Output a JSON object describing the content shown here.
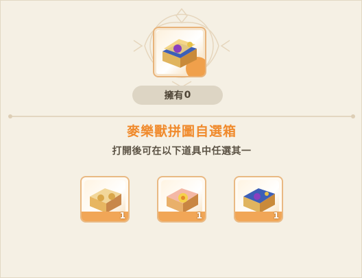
{
  "owned": {
    "label": "擁有",
    "count": "0"
  },
  "title": "麥樂獸拼圖自選箱",
  "subtitle": "打開後可在以下道具中任選其一",
  "items": [
    {
      "name": "item-chest-gold",
      "count": "1",
      "icon": "gold-chest-icon",
      "accent": "#e8c66a"
    },
    {
      "name": "item-chest-pink",
      "count": "1",
      "icon": "pink-chest-icon",
      "accent": "#f29a8a"
    },
    {
      "name": "item-chest-blue",
      "count": "1",
      "icon": "blue-chest-icon",
      "accent": "#3d5fb7"
    }
  ],
  "colors": {
    "accent": "#f08a2c",
    "background": "#f5f0e4",
    "pill": "#ddd5c4"
  }
}
